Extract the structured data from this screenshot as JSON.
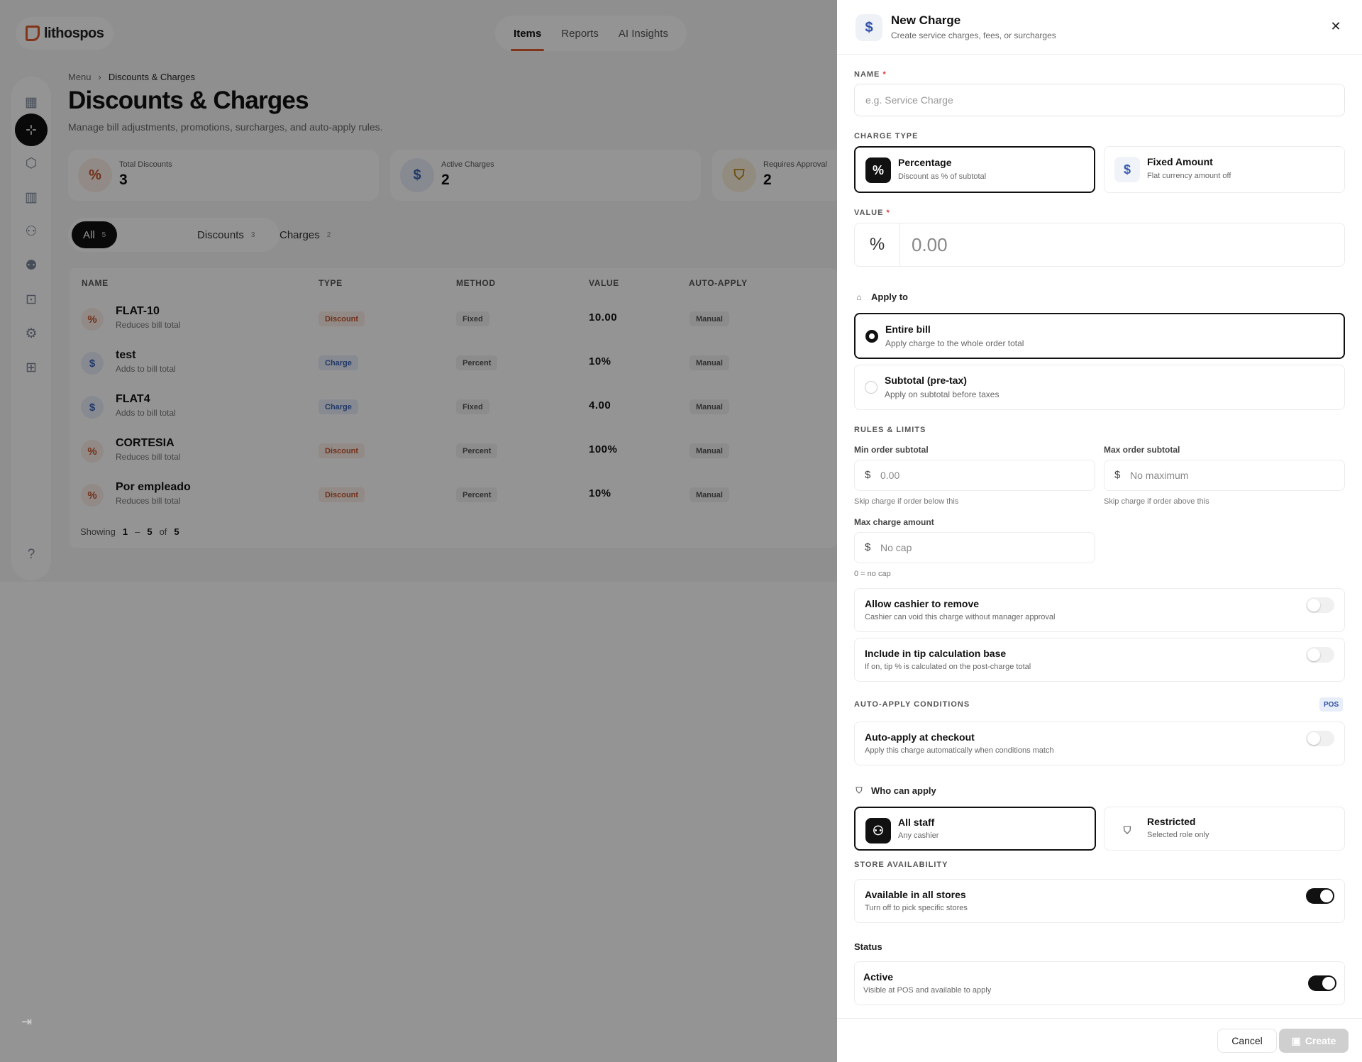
{
  "app": {
    "logo_text": "lithospos",
    "nav": [
      "Items",
      "Reports",
      "AI Insights"
    ],
    "breadcrumb": [
      "Menu",
      "Discounts & Charges"
    ],
    "title": "Discounts & Charges",
    "subtitle": "Manage bill adjustments, promotions, surcharges, and auto-apply rules.",
    "stats": [
      {
        "label": "Total Discounts",
        "value": "3",
        "icon": "percent-icon"
      },
      {
        "label": "Active Charges",
        "value": "2",
        "icon": "dollar-icon"
      },
      {
        "label": "Requires Approval",
        "value": "2",
        "icon": "shield-icon"
      }
    ],
    "filters": [
      {
        "label": "All",
        "count": "5"
      },
      {
        "label": "Discounts",
        "count": "3"
      },
      {
        "label": "Charges",
        "count": "2"
      }
    ],
    "columns": [
      "NAME",
      "TYPE",
      "METHOD",
      "VALUE",
      "AUTO-APPLY"
    ],
    "rows": [
      {
        "name": "FLAT-10",
        "sub": "Reduces bill total",
        "type": "Discount",
        "method": "Fixed",
        "value": "10.00",
        "auto": "Manual"
      },
      {
        "name": "test",
        "sub": "Adds to bill total",
        "type": "Charge",
        "method": "Percent",
        "value": "10%",
        "auto": "Manual"
      },
      {
        "name": "FLAT4",
        "sub": "Adds to bill total",
        "type": "Charge",
        "method": "Fixed",
        "value": "4.00",
        "auto": "Manual"
      },
      {
        "name": "CORTESIA",
        "sub": "Reduces bill total",
        "type": "Discount",
        "method": "Percent",
        "value": "100%",
        "auto": "Manual"
      },
      {
        "name": "Por empleado",
        "sub": "Reduces bill total",
        "type": "Discount",
        "method": "Percent",
        "value": "10%",
        "auto": "Manual"
      }
    ],
    "pager": {
      "prefix": "Showing",
      "from": "1",
      "dash": "–",
      "to": "5",
      "of": "of",
      "total": "5"
    }
  },
  "drawer": {
    "title": "New Charge",
    "subtitle": "Create service charges, fees, or surcharges",
    "name_label": "NAME",
    "name_placeholder": "e.g. Service Charge",
    "charge_type_label": "CHARGE TYPE",
    "charge_types": [
      {
        "title": "Percentage",
        "sub": "Discount as % of subtotal",
        "selected": true
      },
      {
        "title": "Fixed Amount",
        "sub": "Flat currency amount off",
        "selected": false
      }
    ],
    "value_label": "VALUE",
    "value_prefix": "%",
    "value_placeholder": "0.00",
    "apply_to_label": "Apply to",
    "apply_options": [
      {
        "title": "Entire bill",
        "sub": "Apply charge to the whole order total",
        "selected": true
      },
      {
        "title": "Subtotal (pre-tax)",
        "sub": "Apply on subtotal before taxes",
        "selected": false
      }
    ],
    "rules_label": "RULES & LIMITS",
    "min_label": "Min order subtotal",
    "min_placeholder": "0.00",
    "min_hint": "Skip charge if order below this",
    "max_label": "Max order subtotal",
    "max_placeholder": "No maximum",
    "max_hint": "Skip charge if order above this",
    "cap_label": "Max charge amount",
    "cap_placeholder": "No cap",
    "cap_hint": "0 = no cap",
    "currency": "$",
    "toggles": [
      {
        "title": "Allow cashier to remove",
        "sub": "Cashier can void this charge without manager approval",
        "on": false
      },
      {
        "title": "Include in tip calculation base",
        "sub": "If on, tip % is calculated on the post-charge total",
        "on": false
      }
    ],
    "auto_label": "AUTO-APPLY CONDITIONS",
    "pos_badge": "POS",
    "auto_toggle": {
      "title": "Auto-apply at checkout",
      "sub": "Apply this charge automatically when conditions match",
      "on": false
    },
    "who_label": "Who can apply",
    "who_options": [
      {
        "title": "All staff",
        "sub": "Any cashier",
        "selected": true
      },
      {
        "title": "Restricted",
        "sub": "Selected role only",
        "selected": false
      }
    ],
    "store_label": "STORE AVAILABILITY",
    "store_toggle": {
      "title": "Available in all stores",
      "sub": "Turn off to pick specific stores",
      "on": true
    },
    "status_label": "Status",
    "status_toggle": {
      "title": "Active",
      "sub": "Visible at POS and available to apply",
      "on": true
    },
    "cancel": "Cancel",
    "create": "Create"
  },
  "colors": {
    "accent": "#e05a2b",
    "discount": "#c4532c",
    "charge": "#3a63b5",
    "selected": "#111111"
  }
}
